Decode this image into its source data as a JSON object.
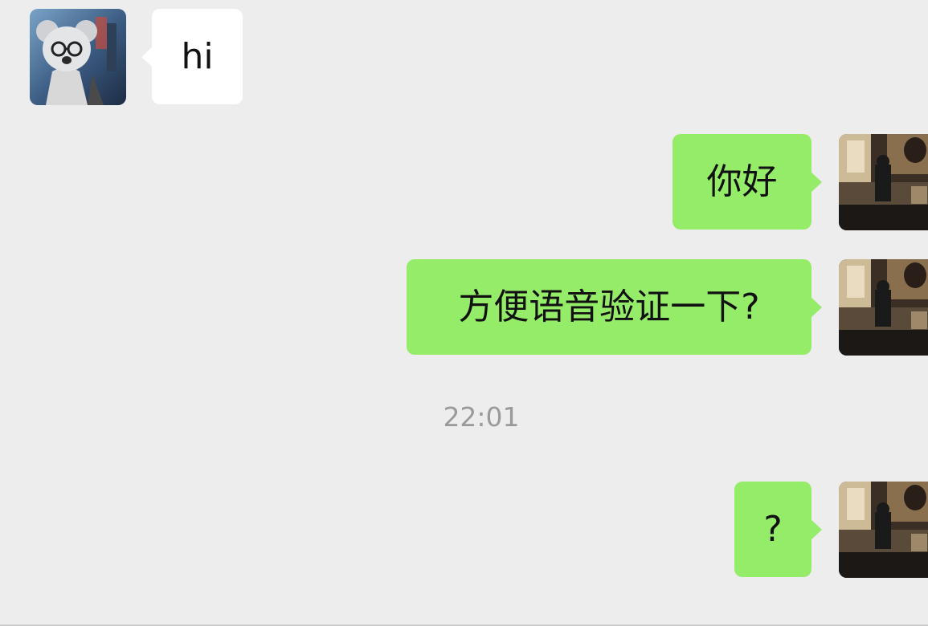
{
  "messages": [
    {
      "sender": "contact",
      "text": "hi"
    },
    {
      "sender": "self",
      "text": "你好"
    },
    {
      "sender": "self",
      "text": "方便语音验证一下?"
    },
    {
      "sender": "self",
      "text": "?"
    }
  ],
  "timestamp": "22:01",
  "avatars": {
    "contact": "koala-character-avatar",
    "self": "photo-avatar"
  },
  "colors": {
    "background": "#ededed",
    "incoming_bubble": "#ffffff",
    "outgoing_bubble": "#95ec69",
    "timestamp_text": "#9a9a9a"
  }
}
